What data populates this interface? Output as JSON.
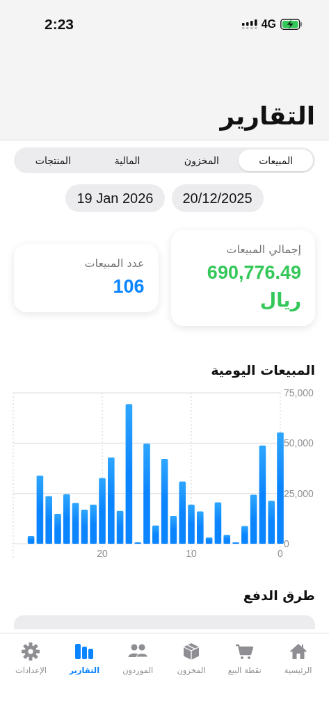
{
  "status_bar": {
    "time": "2:23",
    "network": "4G"
  },
  "title": "التقارير",
  "tabs": [
    {
      "label": "المبيعات",
      "selected": true
    },
    {
      "label": "المخزون",
      "selected": false
    },
    {
      "label": "المالية",
      "selected": false
    },
    {
      "label": "المنتجات",
      "selected": false
    }
  ],
  "date_range": [
    {
      "label": "20/12/2025"
    },
    {
      "label": "19 Jan 2026"
    }
  ],
  "summary_cards": [
    {
      "label": "إجمالي المبيعات",
      "value": "690,776.49",
      "unit": "ريال",
      "color": "#34c759"
    },
    {
      "label": "عدد المبيعات",
      "value": "106",
      "color": "#0a84ff"
    }
  ],
  "daily_sales": {
    "title": "المبيعات اليومية",
    "chart_data": {
      "type": "bar",
      "x": [
        28,
        27,
        26,
        25,
        24,
        23,
        22,
        21,
        20,
        19,
        18,
        17,
        16,
        15,
        14,
        13,
        12,
        11,
        10,
        9,
        8,
        7,
        6,
        5,
        4,
        3,
        2,
        1,
        0
      ],
      "series": [
        {
          "color": "#0a84ff",
          "values": [
            3800,
            33900,
            23700,
            14900,
            24600,
            20300,
            16900,
            19400,
            32700,
            42900,
            16300,
            69400,
            700,
            49800,
            9100,
            42200,
            13800,
            30900,
            19400,
            16100,
            3100,
            20600,
            4400,
            700,
            8800,
            24400,
            48800,
            21300,
            55300
          ]
        }
      ],
      "grid": true,
      "xlim": [
        30,
        0
      ],
      "ylim": [
        0,
        75000
      ],
      "xticks": [
        0,
        10,
        20
      ],
      "yticks": [
        {
          "value": 0,
          "label": "0"
        },
        {
          "value": 25000,
          "label": "25,000"
        },
        {
          "value": 50000,
          "label": "50,000"
        },
        {
          "value": 75000,
          "label": "75,000"
        }
      ]
    }
  },
  "payment_methods": {
    "title": "طرق الدفع"
  },
  "tab_bar": [
    {
      "label": "الرئيسية",
      "kind": "home",
      "selected": false
    },
    {
      "label": "نقطة البيع",
      "kind": "cart",
      "selected": false
    },
    {
      "label": "المخزون",
      "kind": "box",
      "selected": false
    },
    {
      "label": "الموردون",
      "kind": "people",
      "selected": false
    },
    {
      "label": "التقارير",
      "kind": "chart",
      "selected": true
    },
    {
      "label": "الإعدادات",
      "kind": "gear",
      "selected": false
    }
  ]
}
